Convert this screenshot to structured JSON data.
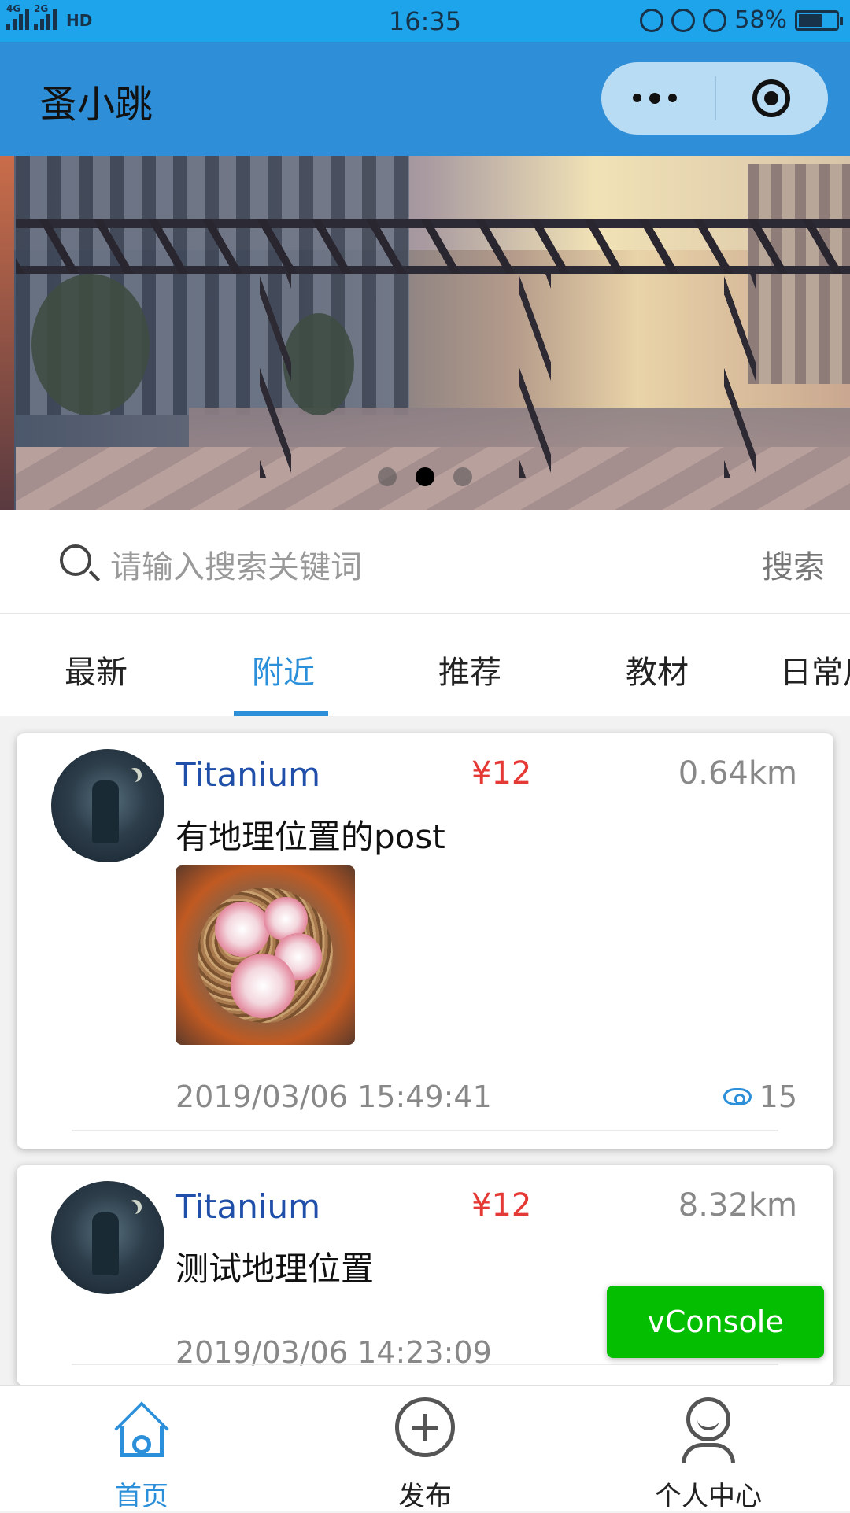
{
  "status_bar": {
    "network_1": "4G",
    "network_2": "2G",
    "hd": "HD",
    "time": "16:35",
    "battery_percent": "58%",
    "battery_level": 0.58
  },
  "nav": {
    "title": "蚤小跳"
  },
  "banner": {
    "slide_count": 3,
    "active_index": 1
  },
  "search": {
    "placeholder": "请输入搜索关键词",
    "button_label": "搜索"
  },
  "tabs": {
    "items": [
      "最新",
      "附近",
      "推荐",
      "教材",
      "日常用"
    ],
    "active": "附近"
  },
  "posts": [
    {
      "username": "Titanium",
      "price": "¥12",
      "distance": "0.64km",
      "title": "有地理位置的post",
      "has_image": true,
      "timestamp": "2019/03/06 15:49:41",
      "views": "15"
    },
    {
      "username": "Titanium",
      "price": "¥12",
      "distance": "8.32km",
      "title": "测试地理位置",
      "has_image": false,
      "timestamp": "2019/03/06 14:23:09"
    }
  ],
  "vconsole": {
    "label": "vConsole"
  },
  "tab_bar": {
    "home": "首页",
    "publish": "发布",
    "profile": "个人中心"
  },
  "colors": {
    "status_bar": "#1da4ea",
    "nav_bar": "#2e8fd8",
    "accent": "#2b8fd9",
    "price": "#e53935",
    "username": "#1f4fa8",
    "vconsole": "#04be02"
  }
}
